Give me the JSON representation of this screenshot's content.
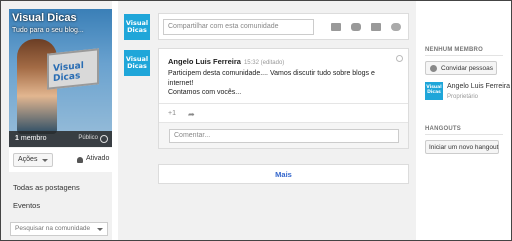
{
  "community": {
    "name": "Visual Dicas",
    "tagline": "Tudo para o seu blog...",
    "logo_text": "Visual Dicas",
    "member_count": "1",
    "member_label": "membro",
    "visibility": "Público",
    "actions_label": "Ações",
    "notifications_label": "Ativado"
  },
  "nav": {
    "items": [
      "Todas as postagens",
      "Eventos"
    ],
    "search_placeholder": "Pesquisar na comunidade"
  },
  "share": {
    "avatar_line1": "Visual",
    "avatar_line2": "Dicas",
    "placeholder": "Compartilhar com esta comunidade",
    "icons": [
      "camera-icon",
      "video-icon",
      "event-icon",
      "link-icon"
    ]
  },
  "post": {
    "author": "Angelo Luis Ferreira",
    "time": "15:32 (editado)",
    "body_line1": "Participem desta comunidade.... Vamos discutir tudo sobre blogs e internet!",
    "body_line2": "Contamos com vocês...",
    "plus_one": "+1",
    "comment_placeholder": "Comentar..."
  },
  "more_label": "Mais",
  "sidebar_right": {
    "members_heading": "NENHUM MEMBRO",
    "invite_label": "Convidar pessoas",
    "member_name": "Angelo Luis Ferreira",
    "member_role": "Proprietário",
    "hangouts_heading": "HANGOUTS",
    "hangout_button": "Iniciar um novo hangout"
  },
  "colors": {
    "accent": "#1fa6d9",
    "link": "#3366cc",
    "panel_bg": "#f1f1f1"
  }
}
